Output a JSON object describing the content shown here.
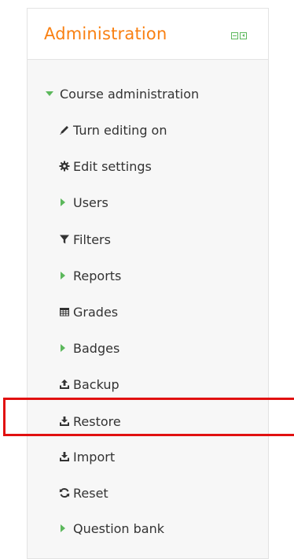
{
  "block": {
    "title": "Administration"
  },
  "course_admin": {
    "label": "Course administration",
    "items": [
      {
        "label": "Turn editing on",
        "icon": "pencil-icon"
      },
      {
        "label": "Edit settings",
        "icon": "gear-icon"
      },
      {
        "label": "Users",
        "icon": "expand-triangle-icon"
      },
      {
        "label": "Filters",
        "icon": "filter-icon"
      },
      {
        "label": "Reports",
        "icon": "expand-triangle-icon"
      },
      {
        "label": "Grades",
        "icon": "grades-table-icon"
      },
      {
        "label": "Badges",
        "icon": "expand-triangle-icon"
      },
      {
        "label": "Backup",
        "icon": "upload-icon"
      },
      {
        "label": "Restore",
        "icon": "download-icon"
      },
      {
        "label": "Import",
        "icon": "download-icon"
      },
      {
        "label": "Reset",
        "icon": "refresh-icon"
      },
      {
        "label": "Question bank",
        "icon": "expand-triangle-icon"
      }
    ]
  },
  "colors": {
    "title": "#f98012",
    "accent": "#5cb85c",
    "highlight": "#e11010"
  }
}
